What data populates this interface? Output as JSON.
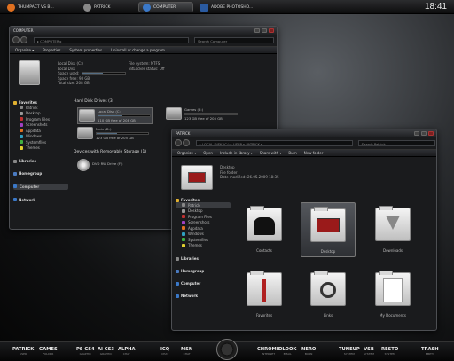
{
  "taskbar": {
    "tasks": [
      {
        "label": "THUMPACT VS B...",
        "icon_color": "#e07020"
      },
      {
        "label": "PATRICK",
        "icon_color": "#888888"
      },
      {
        "label": "COMPUTER",
        "icon_color": "#3a78c8"
      },
      {
        "label": "ADOBE PHOTOSHO...",
        "icon_color": "#2a5aa0"
      }
    ],
    "clock": "18:41"
  },
  "computer_window": {
    "title": "COMPUTER",
    "address": "▸ COMPUTER ▸",
    "search_placeholder": "Search Computer",
    "toolbar": [
      "Organize ▾",
      "Properties",
      "System properties",
      "Uninstall or change a program"
    ],
    "details": {
      "name": "Local Disk (C:)",
      "type": "Local Disk",
      "space_used_label": "Space used:",
      "space_free": "Space free: 98 GB",
      "total_size": "Total size: 208 GB",
      "fs": "File system: NTFS",
      "bitlocker": "BitLocker status: Off"
    },
    "sidebar": [
      {
        "group": "Favorites",
        "items": [
          "Patrick",
          "Desktop",
          "Program Files",
          "Screenshots",
          "Appdata",
          "Windows",
          "Systemfiles",
          "Themes"
        ]
      },
      {
        "group": "Libraries",
        "items": []
      },
      {
        "group": "Homegroup",
        "items": []
      },
      {
        "group": "Computer",
        "items": []
      },
      {
        "group": "Network",
        "items": []
      }
    ],
    "hdd_header": "Hard Disk Drives (3)",
    "drives": [
      {
        "name": "Local Disk (C:)",
        "free": "110 GB free of 208 GB",
        "used": 0.47
      },
      {
        "name": "Games (E:)",
        "free": "123 GB free of 205 GB",
        "used": 0.4
      },
      {
        "name": "Main (D:)",
        "free": "123 GB free of 205 GB",
        "used": 0.4
      }
    ],
    "removable_header": "Devices with Removable Storage (1)",
    "removable": [
      {
        "name": "DVD RW Drive (F:)"
      }
    ]
  },
  "patrick_window": {
    "title": "PATRICK",
    "address": "▸ LOCAL DISK (C:) ▸ USER ▸ PATRICK ▸",
    "search_placeholder": "Search Patrick",
    "toolbar": [
      "Organize ▾",
      "Open",
      "Include in library ▾",
      "Share with ▾",
      "Burn",
      "New folder"
    ],
    "details": {
      "name": "Desktop",
      "type": "File folder",
      "modified": "Date modified: 26.05.2009 18:35"
    },
    "sidebar": [
      {
        "group": "Favorites",
        "items": [
          "Patrick",
          "Desktop",
          "Program Files",
          "Screenshots",
          "Appdata",
          "Windows",
          "Systemfiles",
          "Themes"
        ]
      },
      {
        "group": "Libraries",
        "items": []
      },
      {
        "group": "Homegroup",
        "items": []
      },
      {
        "group": "Computer",
        "items": []
      },
      {
        "group": "Network",
        "items": []
      }
    ],
    "folders": [
      "Contacts",
      "Desktop",
      "Downloads",
      "Favorites",
      "Links",
      "My Documents"
    ]
  },
  "dock": [
    {
      "title": "PATRICK",
      "sub": "USER"
    },
    {
      "title": "GAMES",
      "sub": "FOLDER"
    },
    {
      "title": "PS CS4",
      "sub": "GRAPHIC"
    },
    {
      "title": "AI CS3",
      "sub": "GRAPHIC"
    },
    {
      "title": "ALPHA",
      "sub": "CHAT"
    },
    {
      "title": "ICQ",
      "sub": "CHAT"
    },
    {
      "title": "MSN",
      "sub": "CHAT"
    },
    {
      "title": "CHROME",
      "sub": "INTERNET"
    },
    {
      "title": "OLOOK",
      "sub": "EMAIL"
    },
    {
      "title": "NERO",
      "sub": "BURN"
    },
    {
      "title": "TUNEUP",
      "sub": "SYSTEM"
    },
    {
      "title": "VSB",
      "sub": "SYSTEM"
    },
    {
      "title": "RESTO",
      "sub": "SYSTEM"
    },
    {
      "title": "TRASH",
      "sub": "EMPTY"
    }
  ],
  "colors": {
    "accent": "#6f8aa3",
    "close": "#7a2020"
  }
}
